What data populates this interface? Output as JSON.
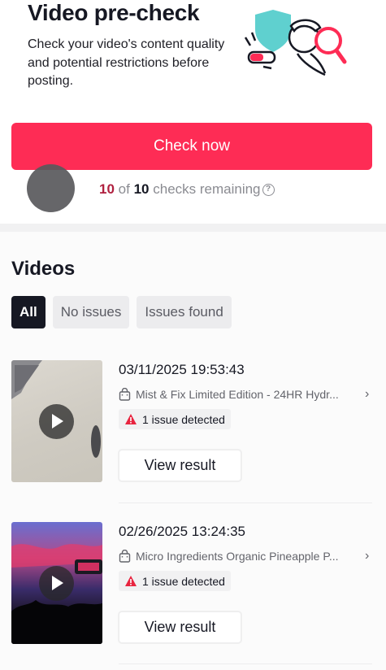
{
  "header": {
    "title": "Video pre-check",
    "description": "Check your video's content quality and potential restrictions before posting.",
    "illustration_icon": "magnifier-shield-illustration"
  },
  "check_button_label": "Check now",
  "remaining": {
    "used": "10",
    "of_text": "of",
    "total": "10",
    "suffix": "checks remaining",
    "help_icon": "question-circle-icon"
  },
  "videos": {
    "title": "Videos",
    "filters": [
      {
        "label": "All",
        "active": true
      },
      {
        "label": "No issues",
        "active": false
      },
      {
        "label": "Issues found",
        "active": false
      }
    ],
    "items": [
      {
        "date": "03/11/2025 19:53:43",
        "product": "Mist & Fix Limited Edition - 24HR Hydr...",
        "issue": "1 issue detected",
        "action": "View result"
      },
      {
        "date": "02/26/2025 13:24:35",
        "product": "Micro Ingredients Organic Pineapple P...",
        "issue": "1 issue detected",
        "action": "View result"
      }
    ]
  },
  "colors": {
    "accent": "#fe2c55",
    "count_red": "#b0203f",
    "warning_red": "#e8243f",
    "teal": "#5fd0cf"
  }
}
